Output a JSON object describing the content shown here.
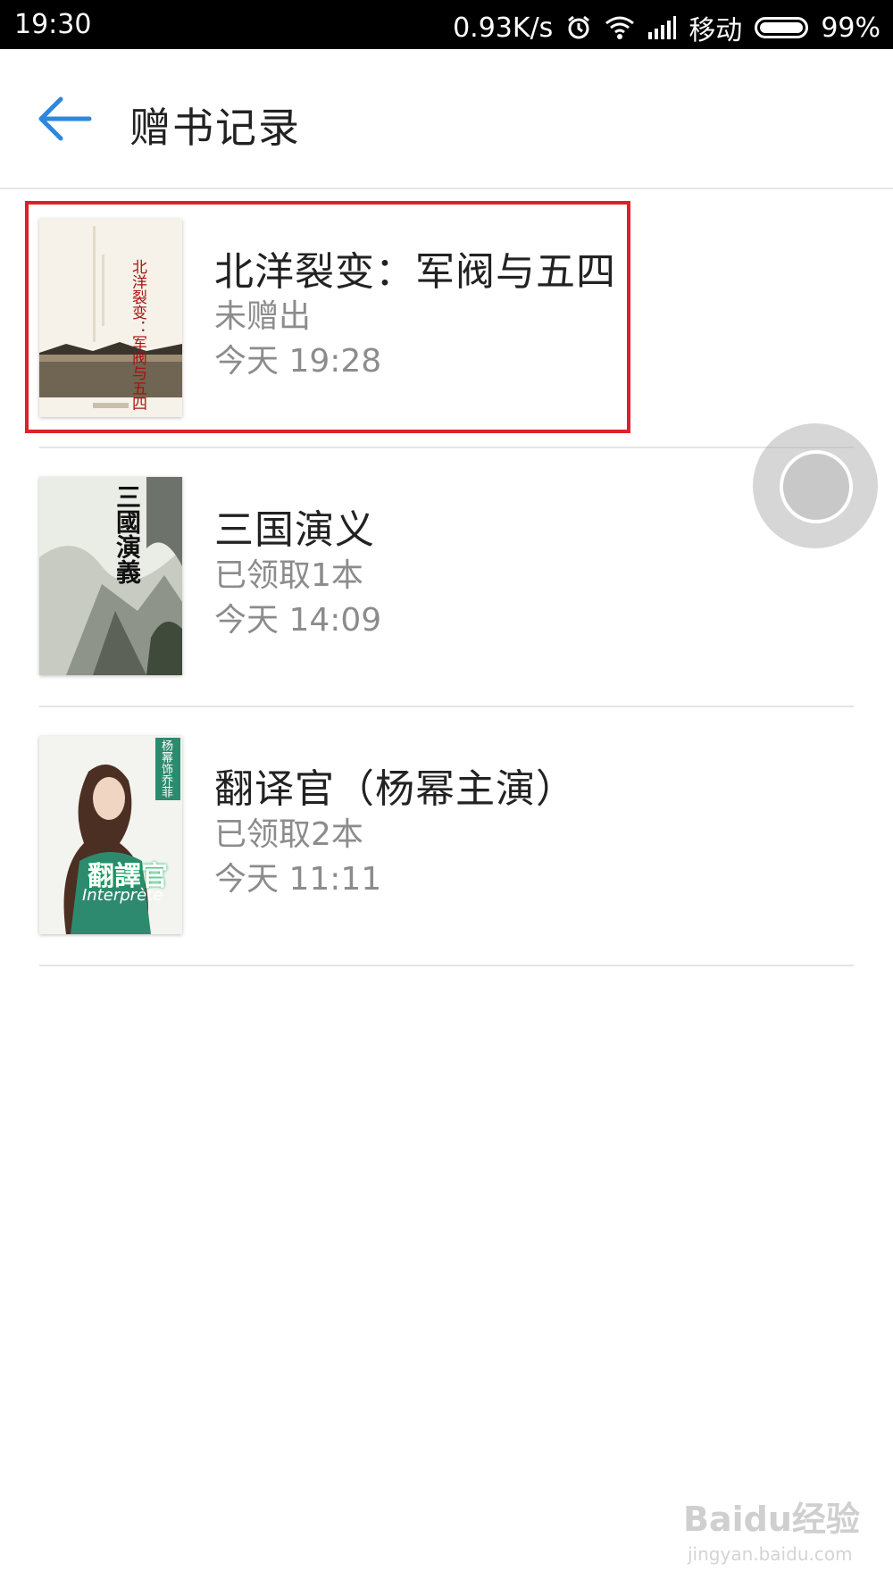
{
  "status_bar": {
    "time": "19:30",
    "net_speed": "0.93K/s",
    "carrier": "移动",
    "battery": "99%",
    "icons": [
      "alarm-icon",
      "wifi-icon",
      "signal-icon",
      "battery-icon"
    ]
  },
  "header": {
    "back_icon": "back-arrow-icon",
    "title": "赠书记录"
  },
  "records": [
    {
      "title": "北洋裂变：军阀与五四",
      "status": "未赠出",
      "time": "今天 19:28",
      "cover_text": "北洋裂变：军阀与五四",
      "highlighted": true
    },
    {
      "title": "三国演义",
      "status": "已领取1本",
      "time": "今天 14:09",
      "cover_text": "三國演義"
    },
    {
      "title": "翻译官（杨幂主演）",
      "status": "已领取2本",
      "time": "今天 11:11",
      "cover_text": "翻譯官",
      "cover_subtext": "Interprète",
      "cover_tag": "杨幂饰乔菲"
    }
  ],
  "colors": {
    "accent_blue": "#2f86de",
    "highlight_red": "#e0202a",
    "text_primary": "#222222",
    "text_secondary": "#8c8c8c"
  },
  "watermark": {
    "main": "Baidu经验",
    "sub": "jingyan.baidu.com"
  }
}
